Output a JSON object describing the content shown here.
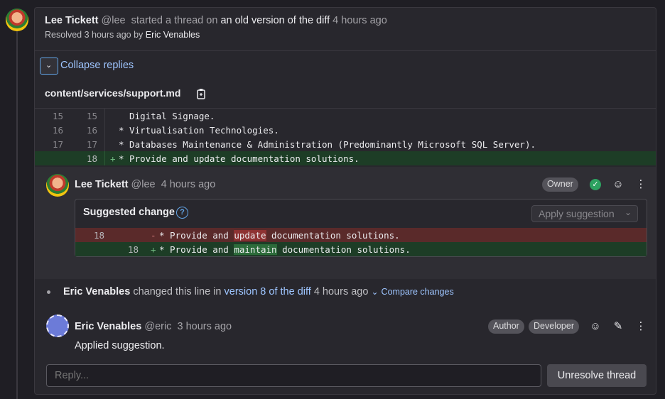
{
  "thread": {
    "author_name": "Lee Tickett",
    "author_handle": "@lee",
    "action": "started a thread on",
    "target": "an old version of the diff",
    "time": "4 hours ago",
    "resolved_text": "Resolved 3 hours ago by",
    "resolved_by": "Eric Venables"
  },
  "collapse_label": "Collapse replies",
  "file": {
    "name": "content/services/support.md"
  },
  "diff_lines": [
    {
      "old": "15",
      "new": "15",
      "marker": "",
      "code": "  Digital Signage.",
      "type": "context"
    },
    {
      "old": "16",
      "new": "16",
      "marker": "",
      "code": "* Virtualisation Technologies.",
      "type": "context"
    },
    {
      "old": "17",
      "new": "17",
      "marker": "",
      "code": "* Databases Maintenance & Administration (Predominantly Microsoft SQL Server).",
      "type": "context"
    },
    {
      "old": "",
      "new": "18",
      "marker": "+",
      "code": "* Provide and update documentation solutions.",
      "type": "added"
    }
  ],
  "note1": {
    "author_name": "Lee Tickett",
    "author_handle": "@lee",
    "time": "4 hours ago",
    "badge": "Owner"
  },
  "suggestion": {
    "title": "Suggested change",
    "apply_label": "Apply suggestion",
    "del_line": "18",
    "del_marker": "-",
    "del_pre": "* Provide and ",
    "del_word": "update",
    "del_post": " documentation solutions.",
    "add_line": "18",
    "add_marker": "+",
    "add_pre": "* Provide and ",
    "add_word": "maintain",
    "add_post": " documentation solutions."
  },
  "system_note": {
    "author": "Eric Venables",
    "text": "changed this line in",
    "link": "version 8 of the diff",
    "time": "4 hours ago",
    "compare": "Compare changes"
  },
  "note2": {
    "author_name": "Eric Venables",
    "author_handle": "@eric",
    "time": "3 hours ago",
    "badge_author": "Author",
    "badge_role": "Developer",
    "body": "Applied suggestion."
  },
  "reply": {
    "placeholder": "Reply..."
  },
  "unresolve_label": "Unresolve thread",
  "colors": {
    "accent": "#63a6e9",
    "link": "#9ec5ff",
    "added_bg": "#1d3d26",
    "removed_bg": "#5a2a2a",
    "success": "#2da160"
  }
}
